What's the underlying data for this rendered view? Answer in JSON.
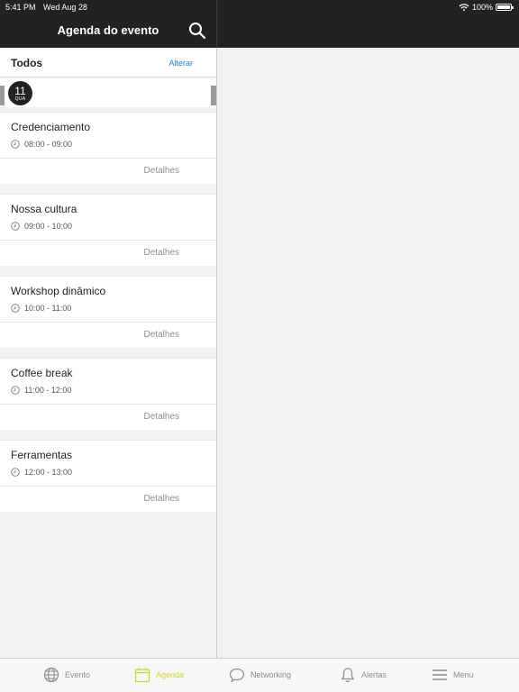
{
  "status_bar": {
    "time": "5:41 PM",
    "date": "Wed Aug 28",
    "battery": "100%"
  },
  "header": {
    "title": "Agenda do evento"
  },
  "filter": {
    "label": "Todos",
    "change_label": "Alterar"
  },
  "date_strip": {
    "selected_day": "11",
    "selected_weekday": "QUA"
  },
  "agenda": {
    "items": [
      {
        "title": "Credenciamento",
        "time": "08:00 - 09:00",
        "details_label": "Detalhes"
      },
      {
        "title": "Nossa cultura",
        "time": "09:00 - 10:00",
        "details_label": "Detalhes"
      },
      {
        "title": "Workshop dinâmico",
        "time": "10:00 - 11:00",
        "details_label": "Detalhes"
      },
      {
        "title": "Coffee break",
        "time": "11:00 - 12:00",
        "details_label": "Detalhes"
      },
      {
        "title": "Ferramentas",
        "time": "12:00 - 13:00",
        "details_label": "Detalhes"
      }
    ]
  },
  "tabbar": {
    "items": [
      {
        "label": "Evento",
        "icon": "globe-icon",
        "active": false
      },
      {
        "label": "Agenda",
        "icon": "calendar-icon",
        "active": true
      },
      {
        "label": "Networking",
        "icon": "chat-bubble-icon",
        "active": false
      },
      {
        "label": "Alertas",
        "icon": "bell-icon",
        "active": false
      },
      {
        "label": "Menu",
        "icon": "hamburger-menu-icon",
        "active": false
      }
    ]
  },
  "colors": {
    "header_bg": "#222222",
    "accent_active_tab": "#c8d43a",
    "link_blue": "#1a7fd4",
    "page_bg": "#f2f2f2"
  }
}
